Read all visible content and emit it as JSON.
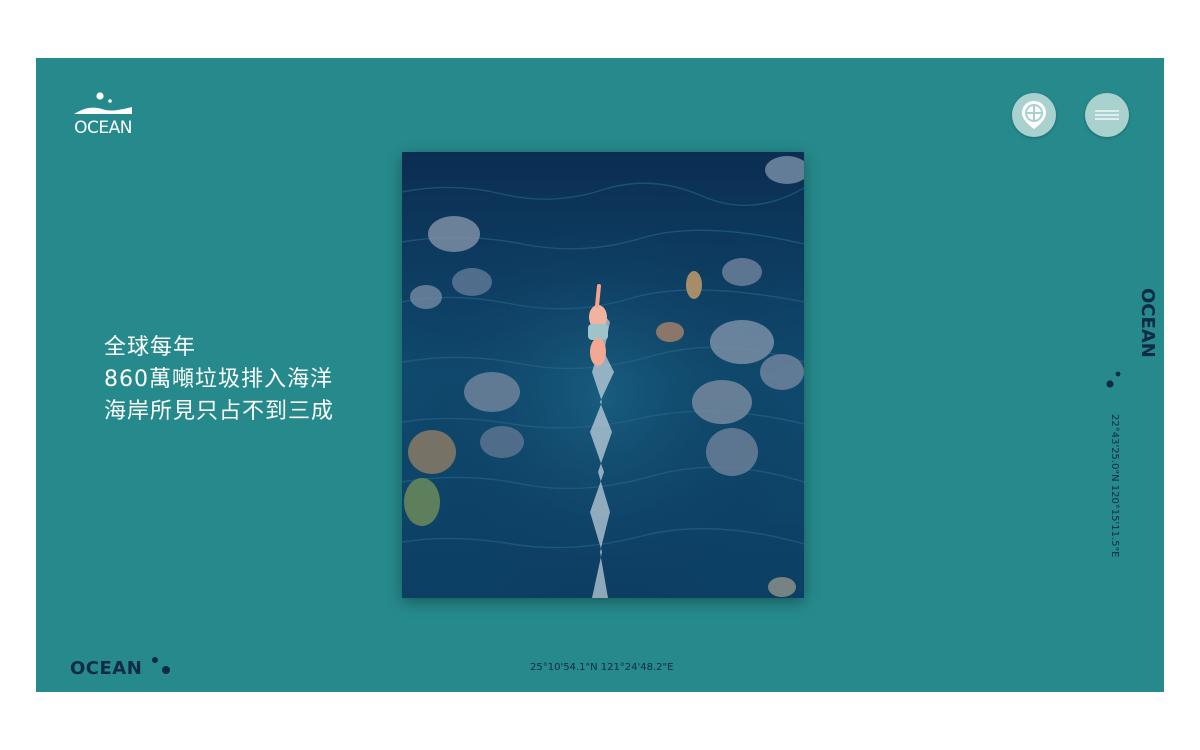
{
  "brand": {
    "logo_text": "OCEAN",
    "side_word": "OCEAN",
    "bottom_word": "OCEAN"
  },
  "buttons": {
    "location_icon": "map-pin-icon",
    "menu_icon": "hamburger-menu-icon"
  },
  "headline": {
    "lines": [
      "全球每年",
      "860萬噸垃圾排入海洋",
      "海岸所見只占不到三成"
    ]
  },
  "coordinates": {
    "side": "22°43'25.0\"N 120°15'11.5\"E",
    "bottom": "25°10'54.1\"N 121°24'48.2\"E"
  },
  "colors": {
    "panel": "#268a8c",
    "dark_text": "#0e2a44",
    "button": "#a9d2cf"
  }
}
